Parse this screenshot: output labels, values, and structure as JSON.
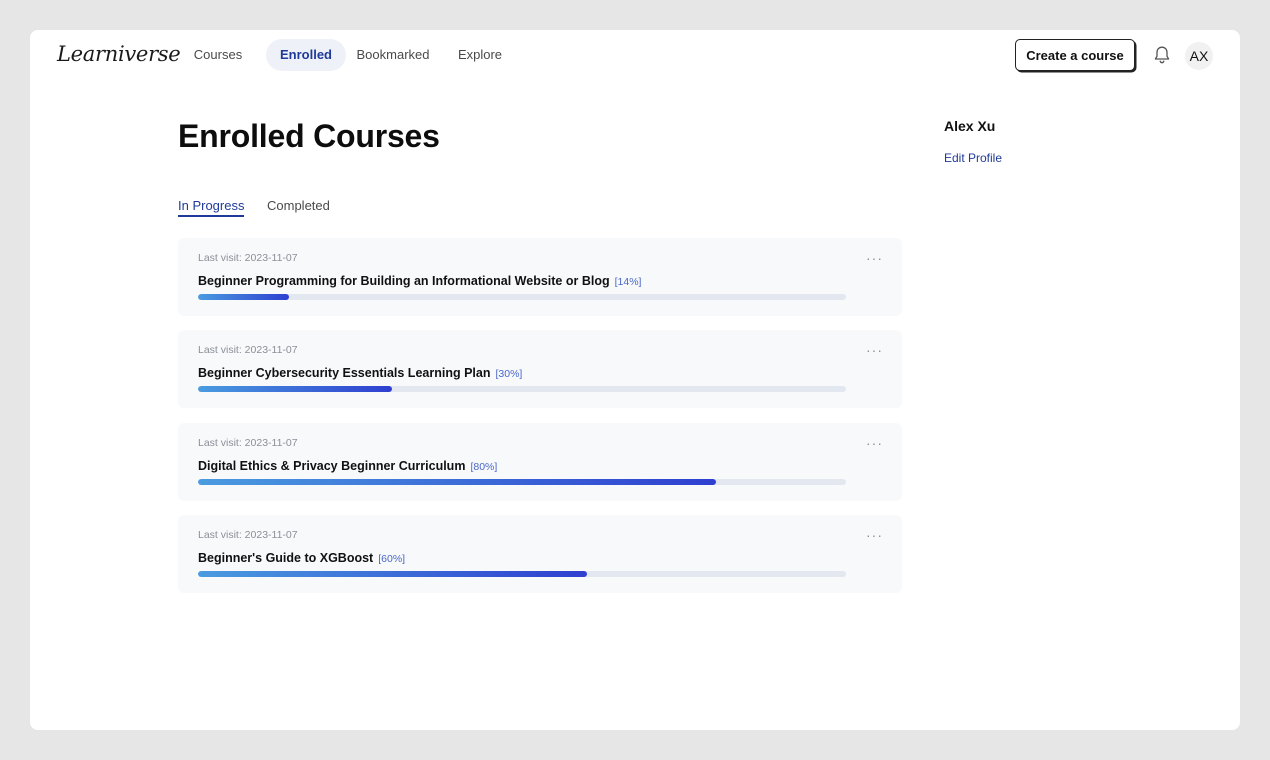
{
  "app": {
    "logo": "Learniverse",
    "create_course_label": "Create a course",
    "avatar_initials": "AX"
  },
  "nav": {
    "items": [
      {
        "label": "Courses",
        "active": false
      },
      {
        "label": "Enrolled",
        "active": true
      },
      {
        "label": "Bookmarked",
        "active": false
      },
      {
        "label": "Explore",
        "active": false
      }
    ]
  },
  "icons": {
    "notifications": "bell-icon",
    "card_menu": "more-horizontal-icon"
  },
  "colors": {
    "accent": "#1f3a9a",
    "progress_start": "#4a9be0",
    "progress_end": "#2f3fd0"
  },
  "main": {
    "title": "Enrolled Courses",
    "tabs": [
      {
        "label": "In Progress",
        "active": true
      },
      {
        "label": "Completed",
        "active": false
      }
    ],
    "courses": [
      {
        "last_visit": "Last visit: 2023-11-07",
        "title": "Beginner Programming for Building an Informational Website or Blog",
        "progress_label": "[14%]",
        "progress": 14
      },
      {
        "last_visit": "Last visit: 2023-11-07",
        "title": "Beginner Cybersecurity Essentials Learning Plan",
        "progress_label": "[30%]",
        "progress": 30
      },
      {
        "last_visit": "Last visit: 2023-11-07",
        "title": "Digital Ethics & Privacy Beginner Curriculum",
        "progress_label": "[80%]",
        "progress": 80
      },
      {
        "last_visit": "Last visit: 2023-11-07",
        "title": "Beginner's Guide to XGBoost",
        "progress_label": "[60%]",
        "progress": 60
      }
    ]
  },
  "profile": {
    "name": "Alex Xu",
    "edit_label": "Edit Profile"
  }
}
